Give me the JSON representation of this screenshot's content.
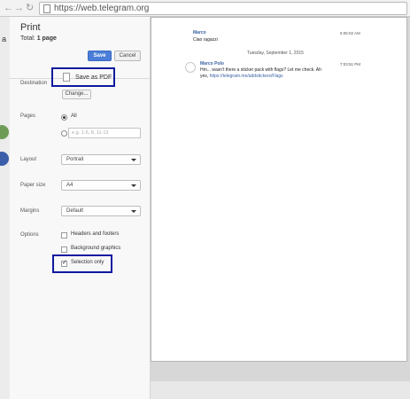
{
  "browser": {
    "url": "https://web.telegram.org",
    "back_icon": "←",
    "forward_icon": "→",
    "reload_icon": "↻"
  },
  "background_page": {
    "partial_text": "a"
  },
  "print_panel": {
    "title": "Print",
    "total_prefix": "Total: ",
    "total_value": "1 page",
    "save_label": "Save",
    "cancel_label": "Cancel",
    "destination_label": "Destination",
    "destination_value": "Save as PDF",
    "change_label": "Change...",
    "pages_label": "Pages",
    "pages_all_label": "All",
    "pages_custom_placeholder": "e.g. 1-5, 8, 11-13",
    "layout_label": "Layout",
    "layout_value": "Portrait",
    "paper_size_label": "Paper size",
    "paper_size_value": "A4",
    "margins_label": "Margins",
    "margins_value": "Default",
    "options_label": "Options",
    "options": [
      {
        "label": "Headers and footers",
        "checked": false
      },
      {
        "label": "Background graphics",
        "checked": false
      },
      {
        "label": "Selection only",
        "checked": true
      }
    ]
  },
  "preview": {
    "messages": [
      {
        "name": "Marco",
        "time": "5:06:02 AM",
        "text": "Ciao ragazzi"
      },
      {
        "name": "Marco Polo",
        "time": "7:03:51 PM",
        "text_line1": "Hm... wasn't there a sticker pack with flags? Let me check. Ah",
        "text_line2_prefix": "yes, ",
        "link": "https://telegram.me/addstickers/Flags"
      }
    ],
    "date_separator": "Tuesday, September 1, 2015"
  },
  "colors": {
    "highlight": "#0e1a9e",
    "save_button": "#4a7ed9",
    "link": "#3a62a3"
  }
}
